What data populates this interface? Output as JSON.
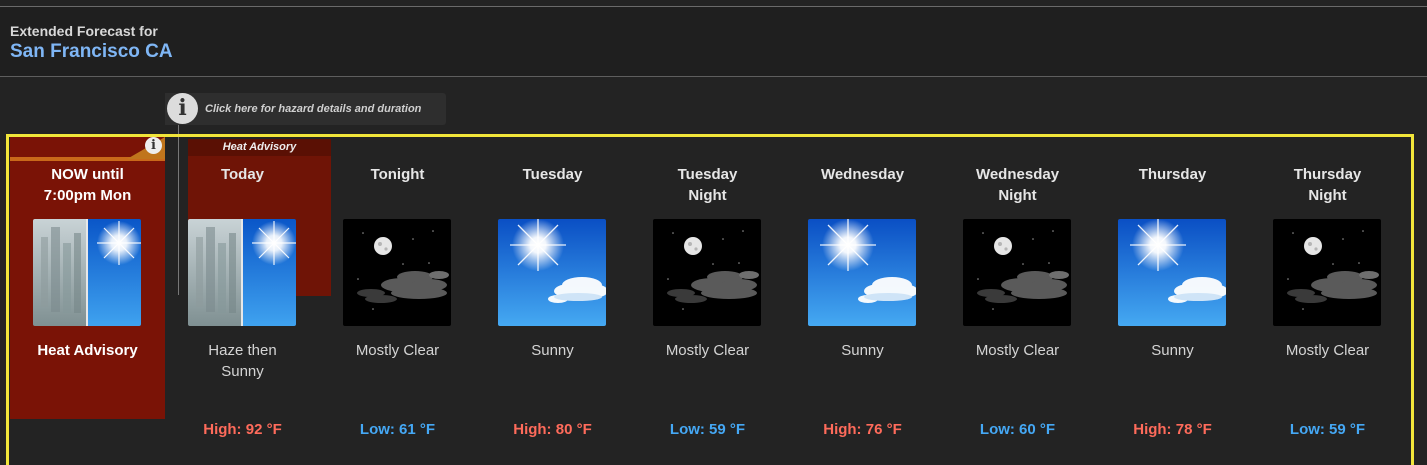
{
  "header": {
    "subtitle": "Extended Forecast for",
    "location": "San Francisco CA"
  },
  "hazard_link": {
    "icon": "info-icon",
    "text": "Click here for hazard details and duration"
  },
  "now": {
    "title_line1": "NOW until",
    "title_line2": "7:00pm Mon",
    "icon": "haze-then-sunny-icon",
    "description": "Heat Advisory"
  },
  "advisory_tab": {
    "label": "Heat Advisory"
  },
  "periods": [
    {
      "name_line1": "Today",
      "name_line2": "",
      "icon": "haze-then-sunny-icon",
      "desc_line1": "Haze then",
      "desc_line2": "Sunny",
      "temp": "High: 92 °F",
      "temp_type": "high"
    },
    {
      "name_line1": "Tonight",
      "name_line2": "",
      "icon": "mostly-clear-night-icon",
      "desc_line1": "Mostly Clear",
      "desc_line2": "",
      "temp": "Low: 61 °F",
      "temp_type": "low"
    },
    {
      "name_line1": "Tuesday",
      "name_line2": "",
      "icon": "sunny-icon",
      "desc_line1": "Sunny",
      "desc_line2": "",
      "temp": "High: 80 °F",
      "temp_type": "high"
    },
    {
      "name_line1": "Tuesday",
      "name_line2": "Night",
      "icon": "mostly-clear-night-icon",
      "desc_line1": "Mostly Clear",
      "desc_line2": "",
      "temp": "Low: 59 °F",
      "temp_type": "low"
    },
    {
      "name_line1": "Wednesday",
      "name_line2": "",
      "icon": "sunny-icon",
      "desc_line1": "Sunny",
      "desc_line2": "",
      "temp": "High: 76 °F",
      "temp_type": "high"
    },
    {
      "name_line1": "Wednesday",
      "name_line2": "Night",
      "icon": "mostly-clear-night-icon",
      "desc_line1": "Mostly Clear",
      "desc_line2": "",
      "temp": "Low: 60 °F",
      "temp_type": "low"
    },
    {
      "name_line1": "Thursday",
      "name_line2": "",
      "icon": "sunny-icon",
      "desc_line1": "Sunny",
      "desc_line2": "",
      "temp": "High: 78 °F",
      "temp_type": "high"
    },
    {
      "name_line1": "Thursday",
      "name_line2": "Night",
      "icon": "mostly-clear-night-icon",
      "desc_line1": "Mostly Clear",
      "desc_line2": "",
      "temp": "Low: 59 °F",
      "temp_type": "low"
    }
  ],
  "colors": {
    "high": "#ff6b5b",
    "low": "#45a8f5",
    "advisory": "#7a1306",
    "frame": "#f1e53a",
    "location": "#7fb6f5"
  }
}
